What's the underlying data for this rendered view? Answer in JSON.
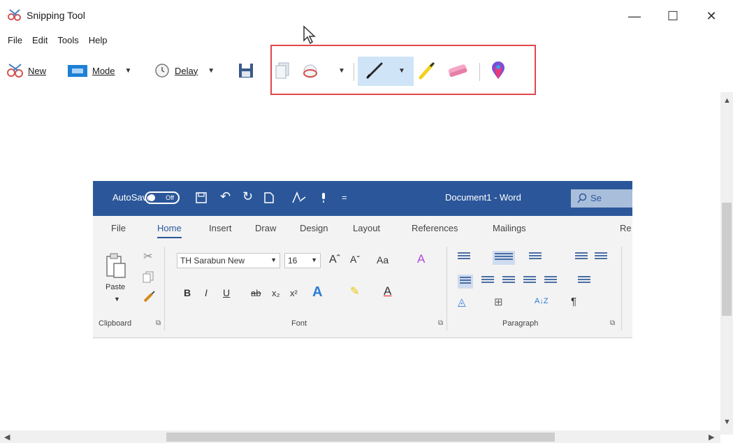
{
  "window": {
    "title": "Snipping Tool",
    "controls": {
      "minimize": "—",
      "maximize": "☐",
      "close": "✕"
    }
  },
  "menu": [
    "File",
    "Edit",
    "Tools",
    "Help"
  ],
  "toolbar": {
    "new_label": "New",
    "mode_label": "Mode",
    "delay_label": "Delay",
    "highlight_color": "#e0474c",
    "active_tool": "pen"
  },
  "capture": {
    "word_title": {
      "autosave": "AutoSave",
      "toggle": "Off",
      "document": "Document1 - Word",
      "search": "Se"
    },
    "tabs": [
      "File",
      "Home",
      "Insert",
      "Draw",
      "Design",
      "Layout",
      "References",
      "Mailings",
      "Re"
    ],
    "ribbon": {
      "paste": "Paste",
      "font_name": "TH Sarabun New",
      "font_size": "16",
      "grow": "Aˆ",
      "shrink": "Aˇ",
      "case": "Aa",
      "bold": "B",
      "italic": "I",
      "underline": "U",
      "strike": "ab",
      "subscript": "x₂",
      "superscript": "x²",
      "pilcrow": "¶",
      "sort": "A↓Z",
      "groups": [
        "Clipboard",
        "Font",
        "Paragraph"
      ]
    }
  }
}
